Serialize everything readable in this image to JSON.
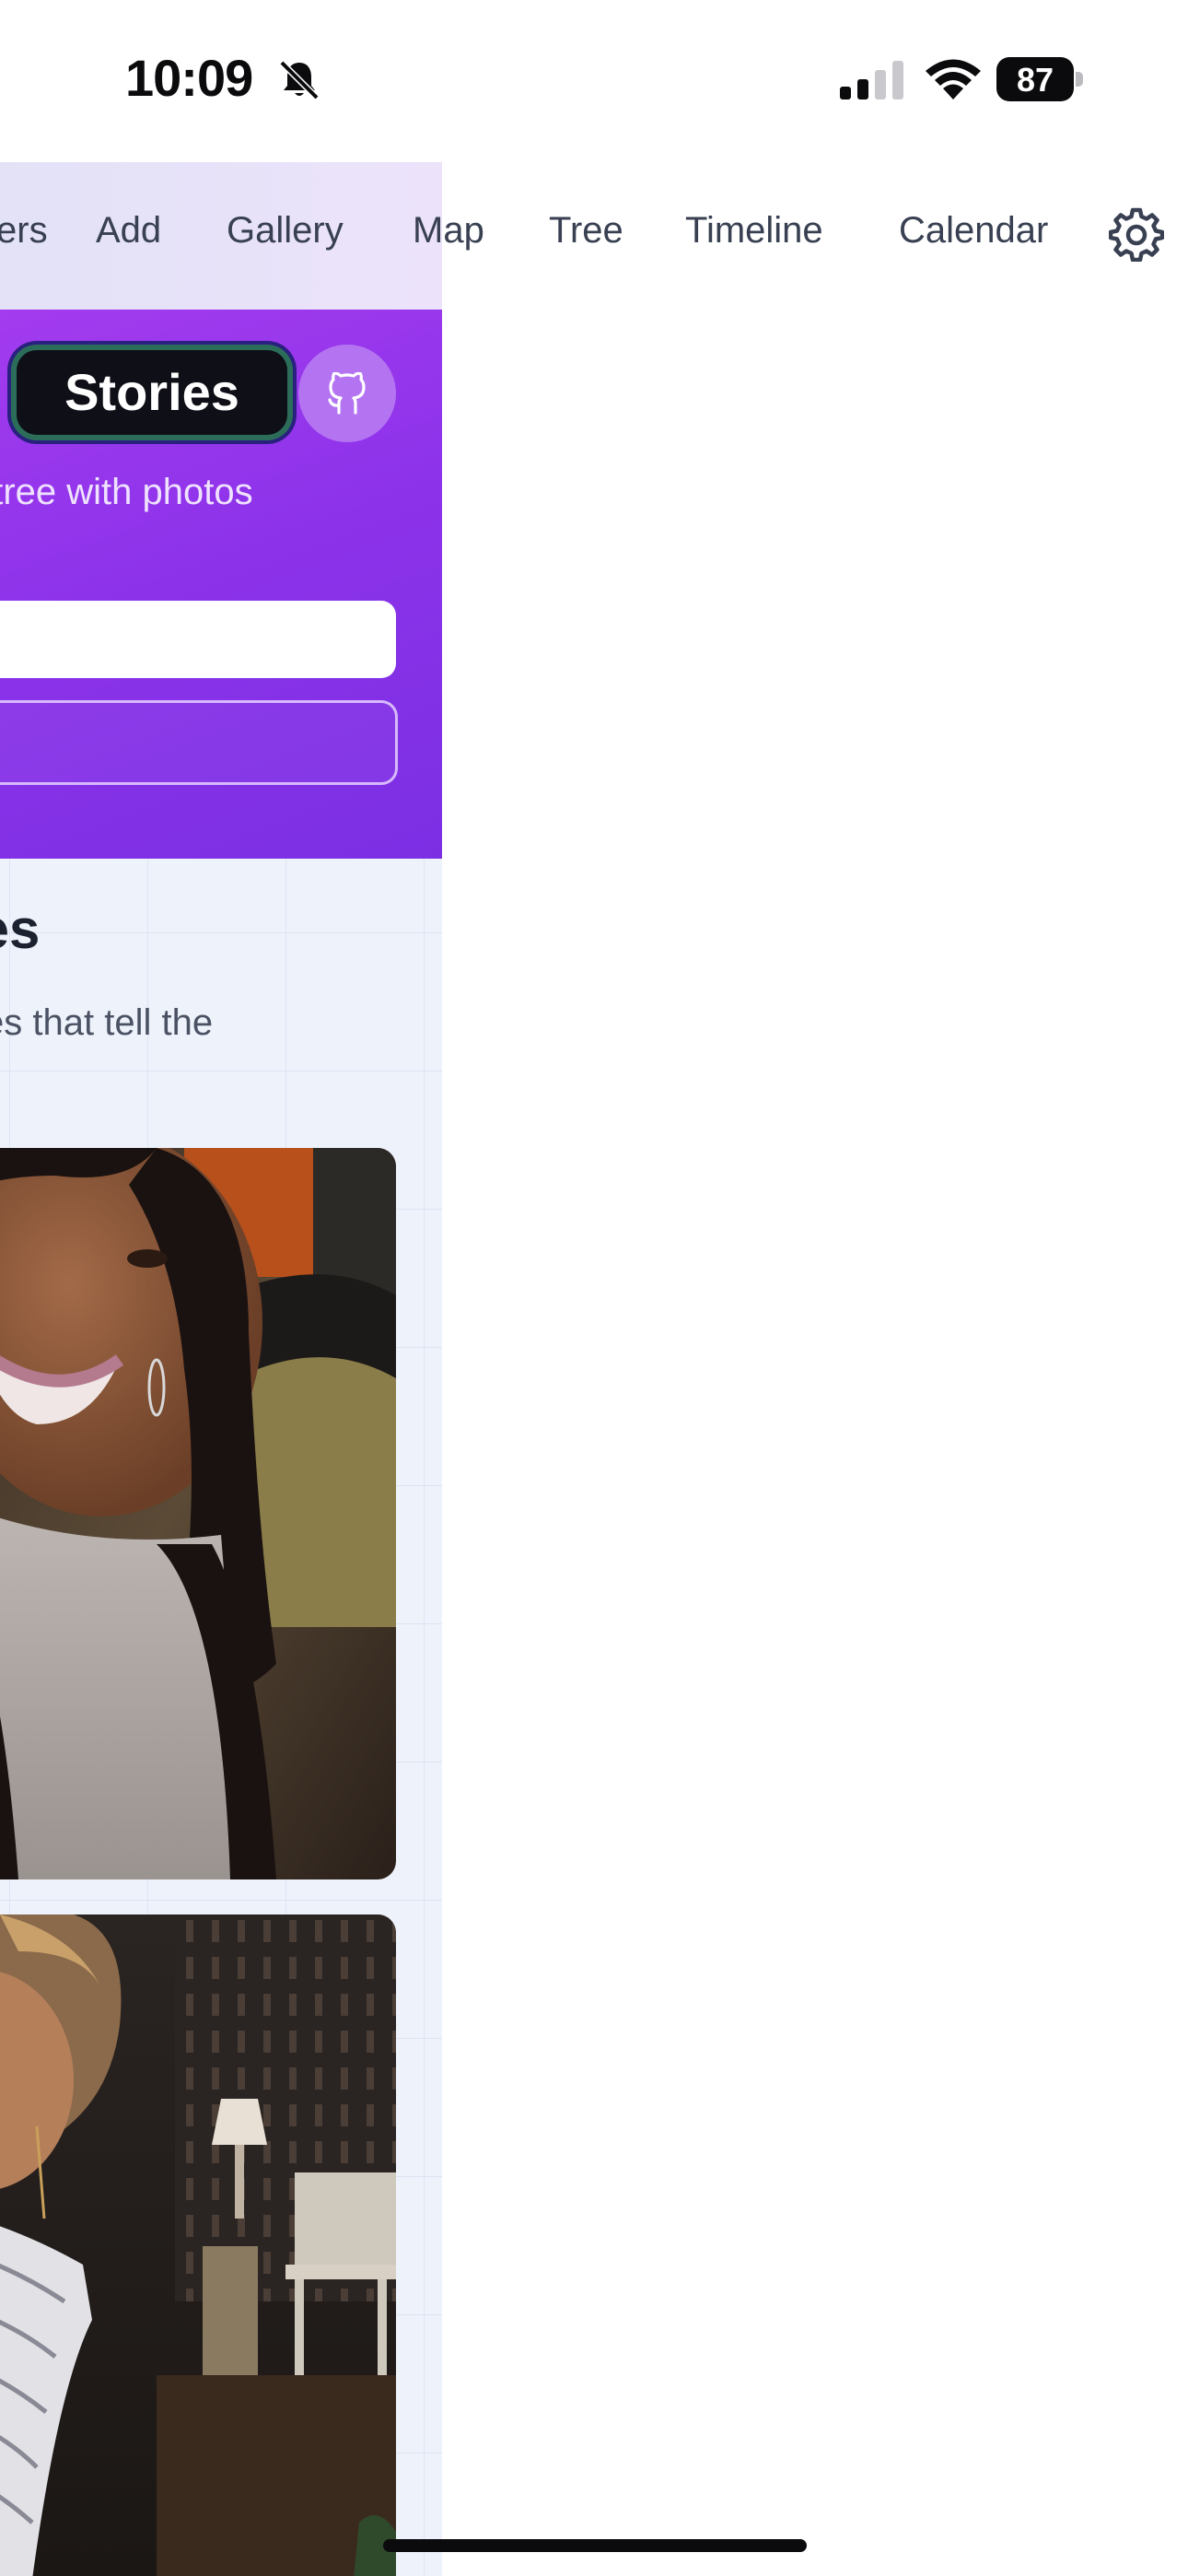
{
  "status_bar": {
    "time": "10:09",
    "battery": "87"
  },
  "nav": {
    "items": [
      "ers",
      "Add",
      "Gallery",
      "Map",
      "Tree",
      "Timeline",
      "Calendar"
    ]
  },
  "hero": {
    "badge": "Stories",
    "description": "mily tree with photos\n.",
    "accent": "#8d33ea"
  },
  "section": {
    "title": "ies",
    "subtitle": "emories that tell the\ndy"
  },
  "photos": [
    {
      "icon": "portrait-woman-smiling-photo"
    },
    {
      "icon": "portrait-woman-dining-room-photo"
    }
  ]
}
